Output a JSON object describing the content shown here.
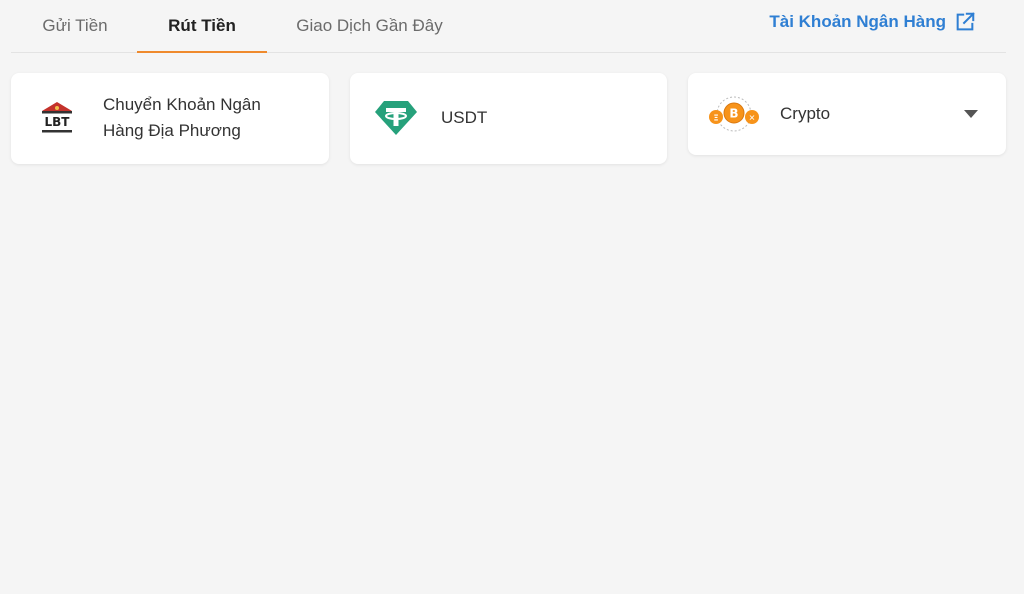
{
  "tabs": [
    {
      "label": "Gửi Tiền",
      "active": false
    },
    {
      "label": "Rút Tiền",
      "active": true
    },
    {
      "label": "Giao Dịch Gần Đây",
      "active": false
    }
  ],
  "bank_link": {
    "label": "Tài Khoản Ngân Hàng",
    "icon": "external-link-icon"
  },
  "colors": {
    "accent": "#ef8a2d",
    "link": "#2f7fd3",
    "usdt": "#26a17b",
    "lbt_red": "#c4322b",
    "bitcoin": "#f7931a"
  },
  "methods": [
    {
      "label": "Chuyển Khoản Ngân Hàng Địa Phương",
      "icon": "lbt-bank-icon",
      "icon_text": "LBT"
    },
    {
      "label": "USDT",
      "icon": "tether-icon"
    },
    {
      "label": "Crypto",
      "icon": "crypto-coins-icon",
      "has_dropdown": true
    }
  ]
}
